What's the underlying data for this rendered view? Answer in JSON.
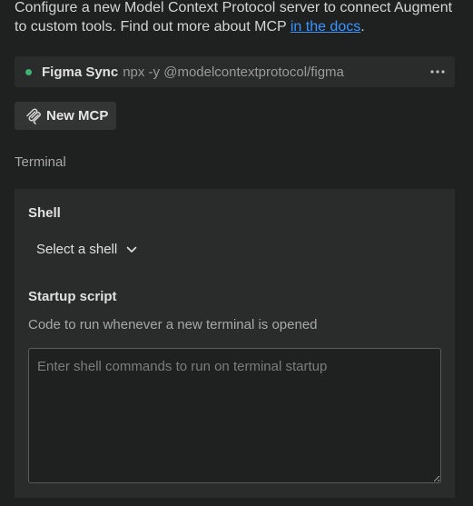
{
  "intro": {
    "text": "Configure a new Model Context Protocol server to connect Augment to custom tools. Find out more about MCP ",
    "link_text": "in the docs",
    "trailing": "."
  },
  "server": {
    "status_color": "#3cb371",
    "name": "Figma Sync",
    "command": "npx -y @modelcontextprotocol/figma",
    "more_icon": "ellipsis-icon"
  },
  "new_mcp": {
    "icon": "mcp-icon",
    "label": "New MCP"
  },
  "terminal": {
    "section_label": "Terminal",
    "shell": {
      "heading": "Shell",
      "selected": "Select a shell",
      "icon": "chevron-down-icon"
    },
    "startup": {
      "heading": "Startup script",
      "description": "Code to run whenever a new terminal is opened",
      "placeholder": "Enter shell commands to run on terminal startup",
      "value": ""
    }
  },
  "colors": {
    "background": "#1f2020",
    "card": "#2a2b2b",
    "link": "#3794ff"
  }
}
